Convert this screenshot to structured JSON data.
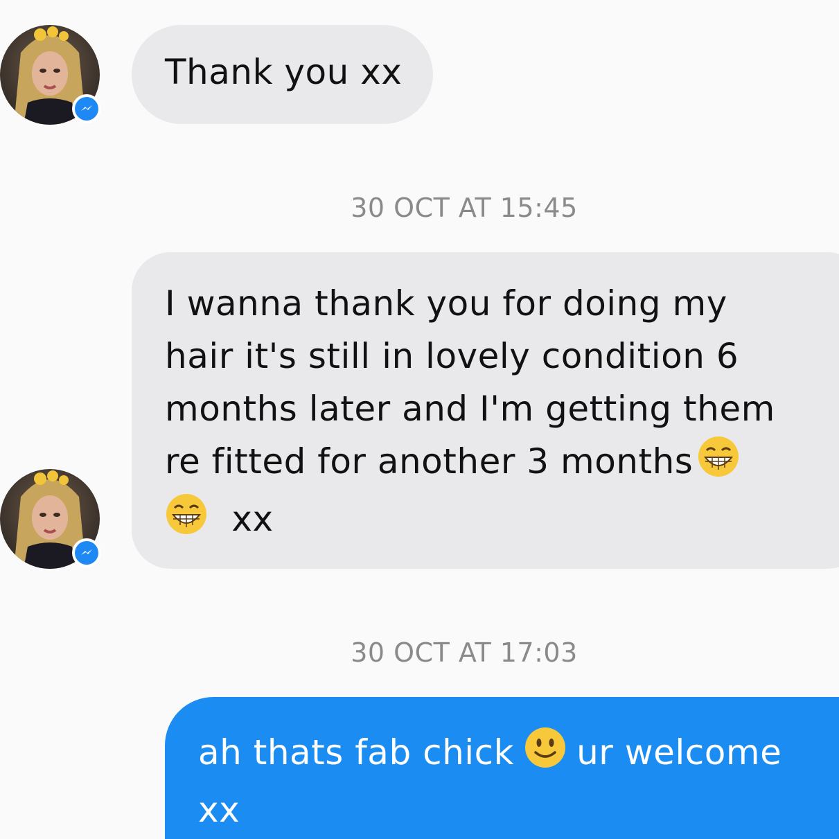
{
  "messages": [
    {
      "sender": "contact",
      "text": "Thank you xx"
    },
    {
      "timestamp": "30 OCT AT 15:45"
    },
    {
      "sender": "contact",
      "lines": [
        "I wanna thank you for doing my",
        "hair it's still in lovely condition 6",
        "months later and I'm getting them",
        "re fitted for another 3 months",
        "xx"
      ],
      "emoji": "grinning-face"
    },
    {
      "timestamp": "30 OCT AT 17:03"
    },
    {
      "sender": "me",
      "lines": [
        "ah thats fab chick",
        "ur welcome",
        "xx"
      ],
      "emoji": "slightly-smiling-face"
    }
  ],
  "theme": {
    "incoming_bubble": "#e9e9eb",
    "outgoing_bubble": "#1a8cf2",
    "timestamp_color": "#8a8a8a",
    "badge_color": "#1e88f5"
  },
  "icons": {
    "avatar_badge": "messenger-icon"
  }
}
